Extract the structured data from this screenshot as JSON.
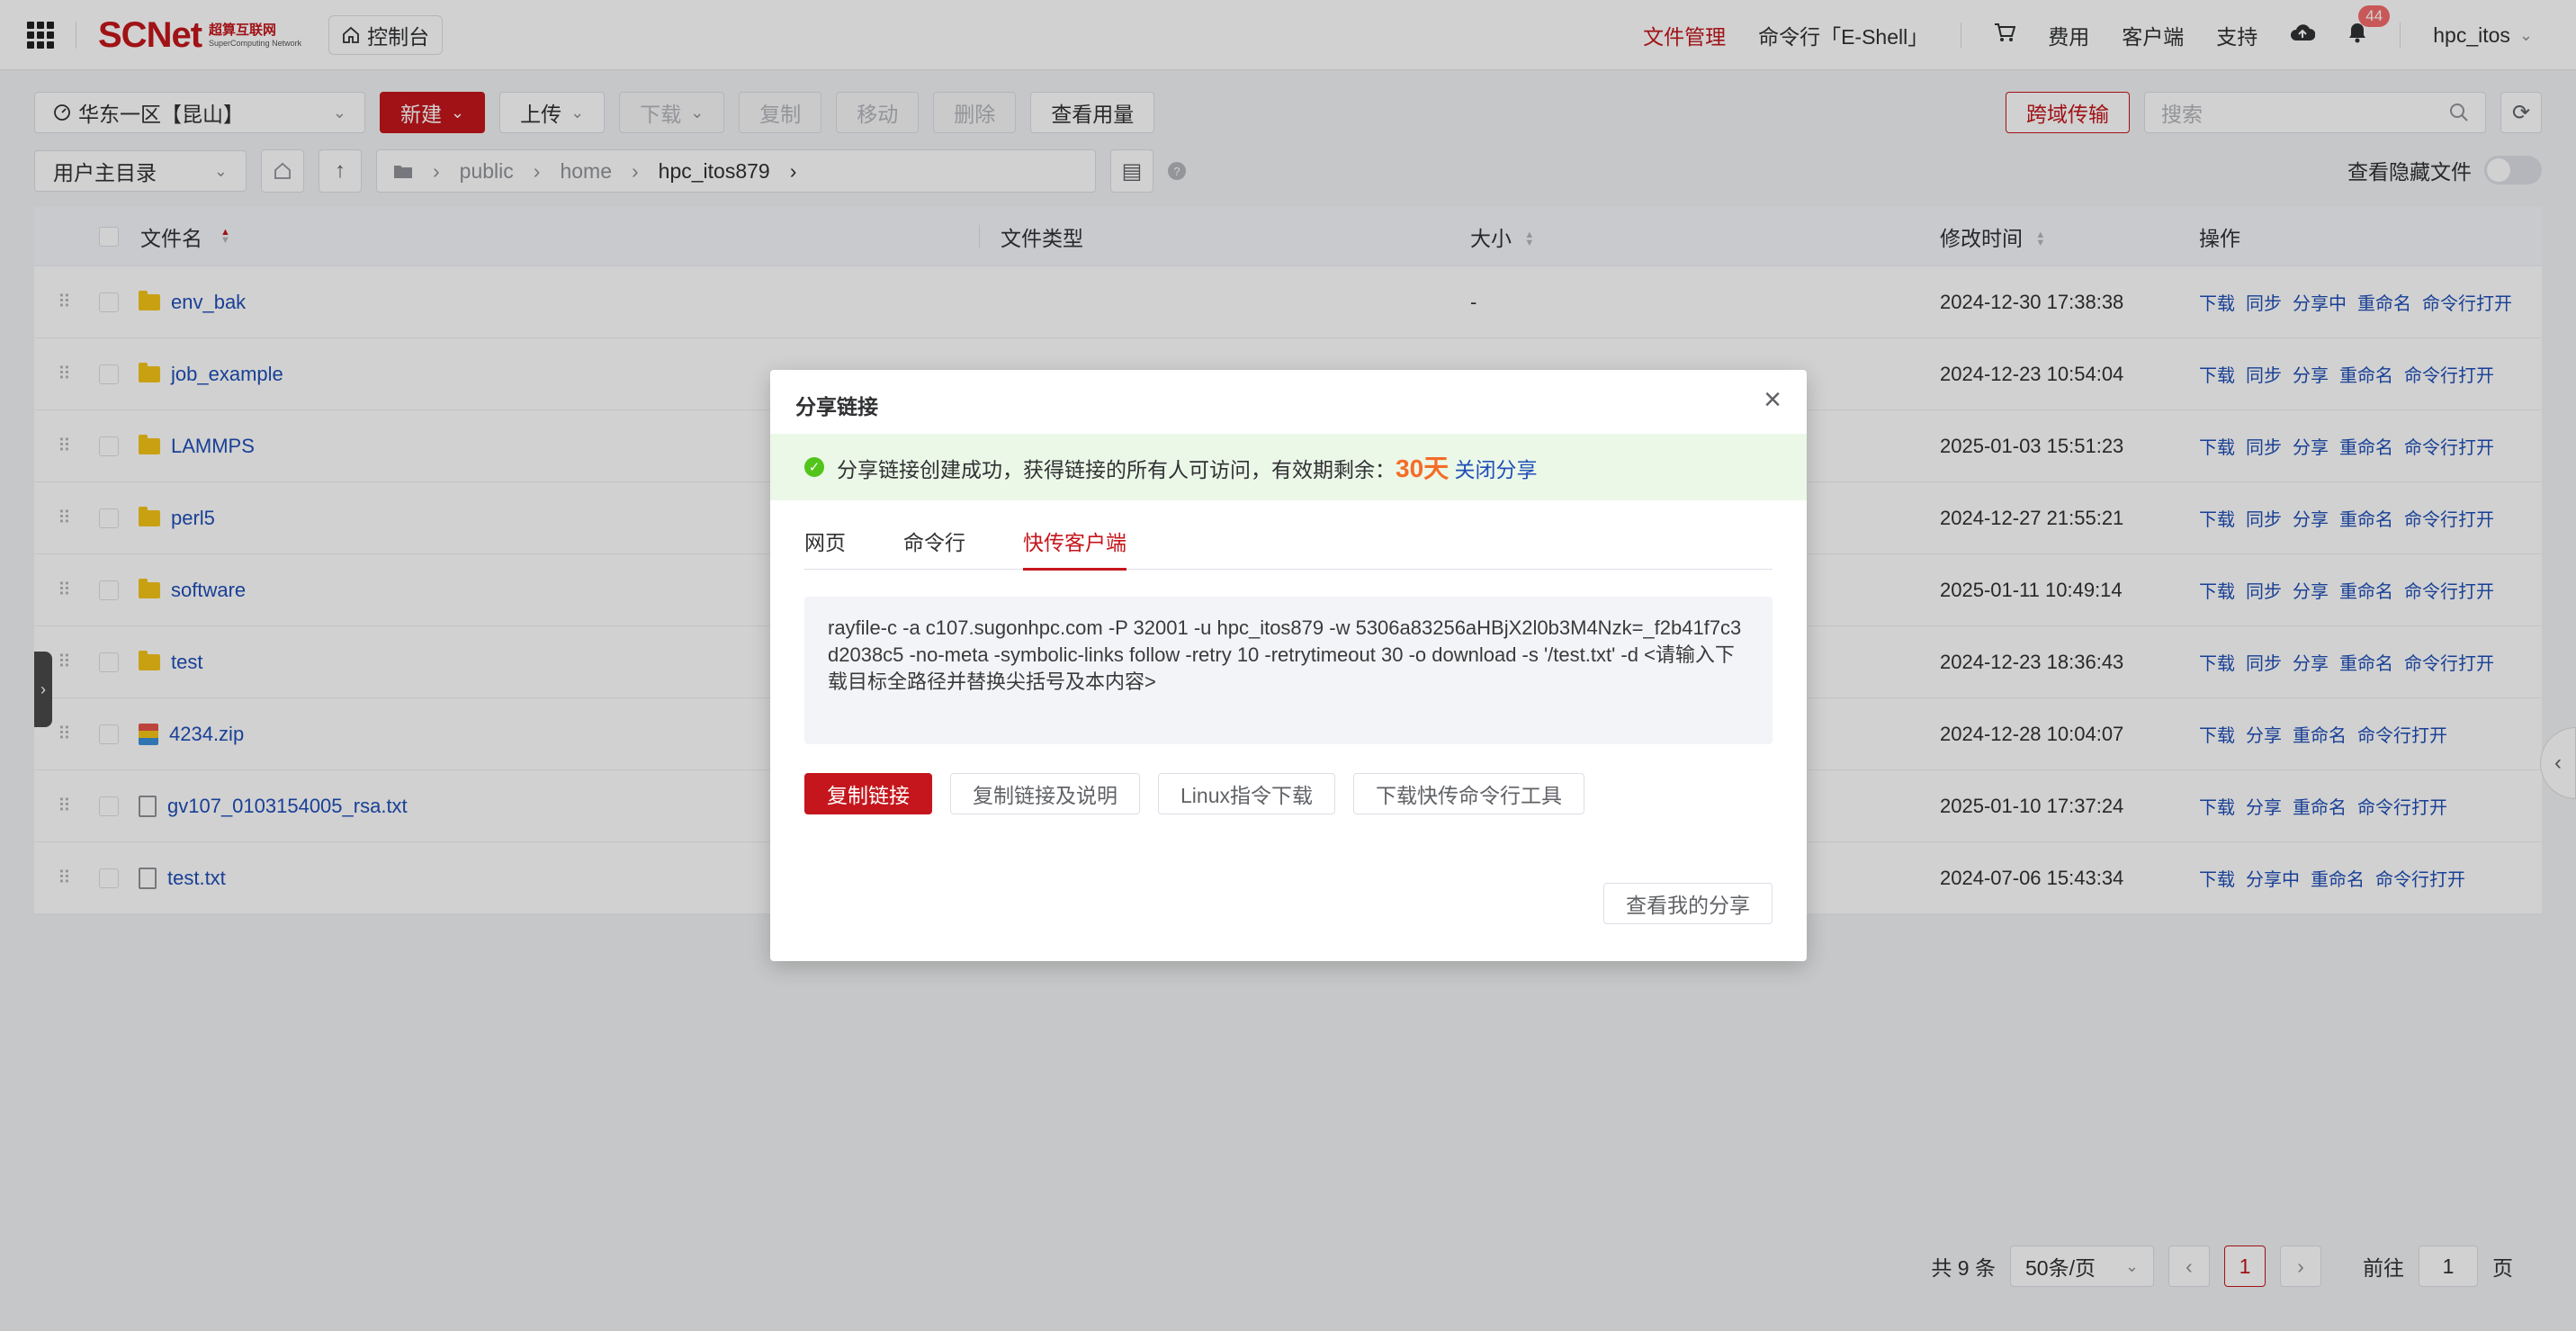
{
  "header": {
    "logo_text": "SCNet",
    "logo_cn": "超算互联网",
    "logo_en": "SuperComputing Network",
    "console_label": "控制台",
    "nav": [
      "文件管理",
      "命令行「E-Shell」"
    ],
    "fee": "费用",
    "client": "客户端",
    "support": "支持",
    "notif_count": "44",
    "user": "hpc_itos"
  },
  "toolbar": {
    "region": "华东一区【昆山】",
    "new_label": "新建",
    "upload_label": "上传",
    "download_label": "下载",
    "copy_label": "复制",
    "move_label": "移动",
    "delete_label": "删除",
    "usage_label": "查看用量",
    "cross_label": "跨域传输",
    "search_placeholder": "搜索"
  },
  "path": {
    "root_select": "用户主目录",
    "segments": [
      "public",
      "home",
      "hpc_itos879"
    ],
    "show_hidden": "查看隐藏文件"
  },
  "table": {
    "headers": {
      "name": "文件名",
      "type": "文件类型",
      "size": "大小",
      "time": "修改时间",
      "ops": "操作"
    },
    "rows": [
      {
        "name": "env_bak",
        "kind": "folder",
        "size": "-",
        "time": "2024-12-30 17:38:38",
        "ops": [
          "下载",
          "同步",
          "分享中",
          "重命名",
          "命令行打开"
        ]
      },
      {
        "name": "job_example",
        "kind": "folder",
        "size": "",
        "time": "2024-12-23 10:54:04",
        "ops": [
          "下载",
          "同步",
          "分享",
          "重命名",
          "命令行打开"
        ]
      },
      {
        "name": "LAMMPS",
        "kind": "folder",
        "size": "",
        "time": "2025-01-03 15:51:23",
        "ops": [
          "下载",
          "同步",
          "分享",
          "重命名",
          "命令行打开"
        ]
      },
      {
        "name": "perl5",
        "kind": "folder",
        "size": "",
        "time": "2024-12-27 21:55:21",
        "ops": [
          "下载",
          "同步",
          "分享",
          "重命名",
          "命令行打开"
        ]
      },
      {
        "name": "software",
        "kind": "folder",
        "size": "",
        "time": "2025-01-11 10:49:14",
        "ops": [
          "下载",
          "同步",
          "分享",
          "重命名",
          "命令行打开"
        ]
      },
      {
        "name": "test",
        "kind": "folder",
        "size": "",
        "time": "2024-12-23 18:36:43",
        "ops": [
          "下载",
          "同步",
          "分享",
          "重命名",
          "命令行打开"
        ]
      },
      {
        "name": "4234.zip",
        "kind": "zip",
        "size": "",
        "time": "2024-12-28 10:04:07",
        "ops": [
          "下载",
          "分享",
          "重命名",
          "命令行打开"
        ]
      },
      {
        "name": "gv107_0103154005_rsa.txt",
        "kind": "txt",
        "size": "",
        "time": "2025-01-10 17:37:24",
        "ops": [
          "下载",
          "分享",
          "重命名",
          "命令行打开"
        ]
      },
      {
        "name": "test.txt",
        "kind": "txt",
        "size": "",
        "time": "2024-07-06 15:43:34",
        "ops": [
          "下载",
          "分享中",
          "重命名",
          "命令行打开"
        ]
      }
    ]
  },
  "pager": {
    "total": "共 9 条",
    "page_size": "50条/页",
    "current": "1",
    "goto_prefix": "前往",
    "goto_value": "1",
    "goto_suffix": "页"
  },
  "modal": {
    "title": "分享链接",
    "alert_text": "分享链接创建成功，获得链接的所有人可访问，有效期剩余：",
    "alert_days": "30天",
    "alert_link": "关闭分享",
    "tabs": [
      "网页",
      "命令行",
      "快传客户端"
    ],
    "active_tab": 2,
    "command": "rayfile-c -a c107.sugonhpc.com -P 32001 -u hpc_itos879 -w 5306a83256aHBjX2l0b3M4Nzk=_f2b41f7c3d2038c5 -no-meta -symbolic-links follow -retry 10 -retrytimeout 30 -o download -s '/test.txt' -d <请输入下载目标全路径并替换尖括号及本内容>",
    "buttons": [
      "复制链接",
      "复制链接及说明",
      "Linux指令下载",
      "下载快传命令行工具"
    ],
    "my_share": "查看我的分享"
  }
}
